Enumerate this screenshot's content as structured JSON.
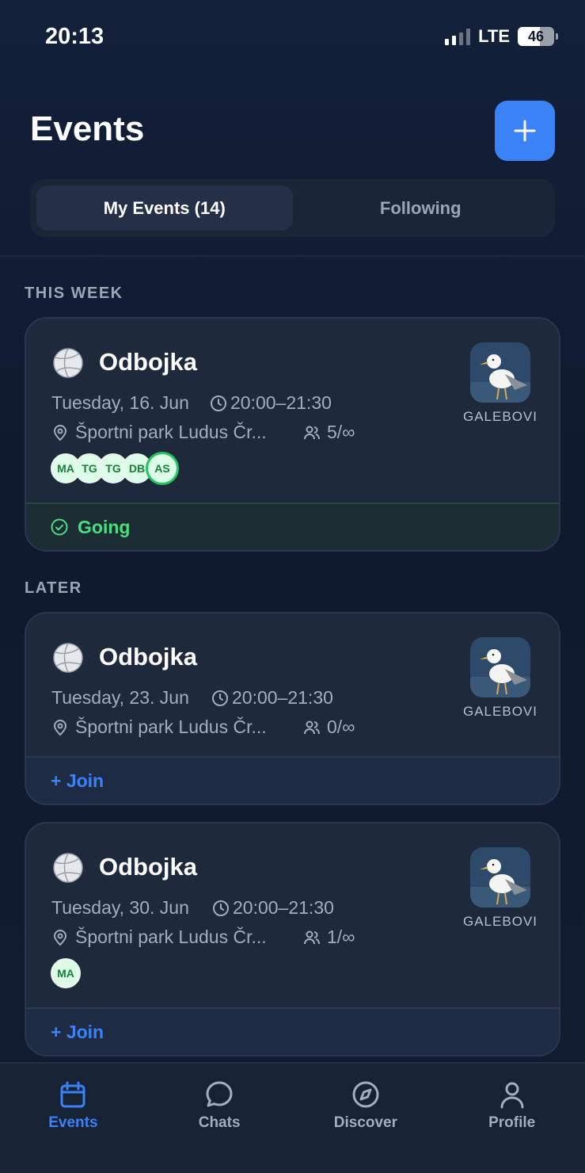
{
  "status_bar": {
    "time": "20:13",
    "network": "LTE",
    "battery": "46"
  },
  "header": {
    "title": "Events",
    "add_icon": "plus-icon"
  },
  "tabs": [
    {
      "label": "My Events (14)",
      "active": true
    },
    {
      "label": "Following",
      "active": false
    }
  ],
  "sections": {
    "this_week": "THIS WEEK",
    "later": "LATER"
  },
  "events": [
    {
      "name": "Odbojka",
      "date": "Tuesday, 16. Jun",
      "time": "20:00–21:30",
      "location": "Športni park Ludus Čr...",
      "participants": "5/∞",
      "team": "GALEBOVI",
      "attendees": [
        "MA",
        "TG",
        "TG",
        "DB",
        "AS"
      ],
      "status": "Going"
    },
    {
      "name": "Odbojka",
      "date": "Tuesday, 23. Jun",
      "time": "20:00–21:30",
      "location": "Športni park Ludus Čr...",
      "participants": "0/∞",
      "team": "GALEBOVI",
      "attendees": [],
      "status": "+ Join"
    },
    {
      "name": "Odbojka",
      "date": "Tuesday, 30. Jun",
      "time": "20:00–21:30",
      "location": "Športni park Ludus Čr...",
      "participants": "1/∞",
      "team": "GALEBOVI",
      "attendees": [
        "MA"
      ],
      "status": "+ Join"
    }
  ],
  "nav": [
    {
      "label": "Events",
      "icon": "calendar-icon",
      "active": true
    },
    {
      "label": "Chats",
      "icon": "chat-bubble-icon",
      "active": false
    },
    {
      "label": "Discover",
      "icon": "compass-icon",
      "active": false
    },
    {
      "label": "Profile",
      "icon": "person-icon",
      "active": false
    }
  ],
  "colors": {
    "accent": "#3b82f6",
    "going": "#4ade80",
    "background": "#101a2e",
    "card": "#1e293b"
  }
}
